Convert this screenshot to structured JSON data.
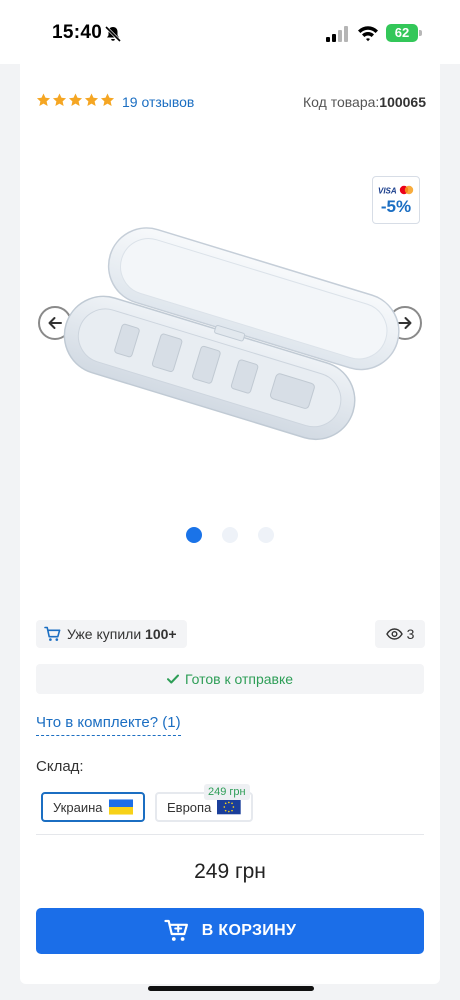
{
  "status_bar": {
    "time": "15:40",
    "battery": "62",
    "icons": [
      "bell-slash-icon",
      "signal-icon",
      "wifi-icon",
      "battery-icon"
    ]
  },
  "product": {
    "rating": 5,
    "rating_max": 5,
    "reviews_label": "19 отзывов",
    "sku_label": "Код товара:",
    "sku_value": "100065",
    "discount": "-5%",
    "gallery": {
      "slides": 3,
      "active_index": 0
    },
    "bought_label": "Уже купили ",
    "bought_value": "100+",
    "views": "3",
    "ready_label": "Готов к отправке",
    "kit_link": "Что в комплекте? (1)",
    "stock_label": "Склад:",
    "stock_options": [
      {
        "label": "Украина",
        "selected": true
      },
      {
        "label": "Европа",
        "price": "249 грн",
        "selected": false
      }
    ],
    "price": "249 грн",
    "cart_button": "В КОРЗИНУ"
  },
  "colors": {
    "accent": "#1b6ee8",
    "link": "#1b6ec2",
    "success": "#2e9e57",
    "star": "#f5a623"
  }
}
